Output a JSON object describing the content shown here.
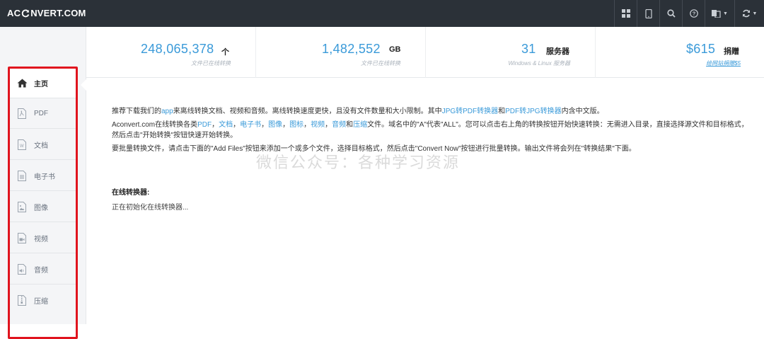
{
  "header": {
    "logo_left": "AC",
    "logo_right": "NVERT.COM",
    "icons": [
      "grid-icon",
      "tablet-icon",
      "search-icon",
      "help-icon",
      "language-icon",
      "refresh-icon"
    ]
  },
  "sidebar": {
    "items": [
      {
        "label": "主页",
        "icon": "home-icon",
        "active": true
      },
      {
        "label": "PDF",
        "icon": "pdf-file-icon"
      },
      {
        "label": "文档",
        "icon": "word-file-icon"
      },
      {
        "label": "电子书",
        "icon": "ebook-file-icon"
      },
      {
        "label": "图像",
        "icon": "image-file-icon"
      },
      {
        "label": "视频",
        "icon": "video-file-icon"
      },
      {
        "label": "音频",
        "icon": "audio-file-icon"
      },
      {
        "label": "压缩",
        "icon": "archive-file-icon"
      }
    ]
  },
  "stats": [
    {
      "number": "248,065,378",
      "unit": "个",
      "sub": "文件已在线转换"
    },
    {
      "number": "1,482,552",
      "unit": "GB",
      "sub": "文件已在线转换"
    },
    {
      "number": "31",
      "unit": "服务器",
      "sub": "Windows & Linux 服务器"
    },
    {
      "number": "$615",
      "unit": "捐赠",
      "sub": "给网站捐赠$5"
    }
  ],
  "content": {
    "p1_a": "推荐下载我们的",
    "p1_link1": "app",
    "p1_b": "来离线转换文档、视频和音频。离线转换速度更快，且没有文件数量和大小限制。其中",
    "p1_link2": "JPG转PDF转换器",
    "p1_c": "和",
    "p1_link3": "PDF转JPG转换器",
    "p1_d": "内含中文版。",
    "p2_a": "Aconvert.com在线转换各类",
    "p2_links": [
      "PDF",
      "文档",
      "电子书",
      "图像",
      "图标",
      "视频",
      "音频"
    ],
    "p2_and": "和",
    "p2_last_link": "压缩",
    "p2_b": "文件。域名中的\"A\"代表\"ALL\"。您可以点击右上角的转换按钮开始快速转换：无需进入目录，直接选择源文件和目标格式，然后点击\"开始转换\"按钮快速开始转换。",
    "p3": "要批量转换文件，请点击下面的\"Add Files\"按钮来添加一个或多个文件，选择目标格式，然后点击\"Convert Now\"按钮进行批量转换。输出文件将会列在\"转换结果\"下面。",
    "section_title": "在线转换器:",
    "init_text": "正在初始化在线转换器..."
  },
  "watermark": "微信公众号：各种学习资源",
  "colors": {
    "accent": "#3a9ad9",
    "topbar": "#2b3138",
    "highlight": "#e0141e"
  }
}
